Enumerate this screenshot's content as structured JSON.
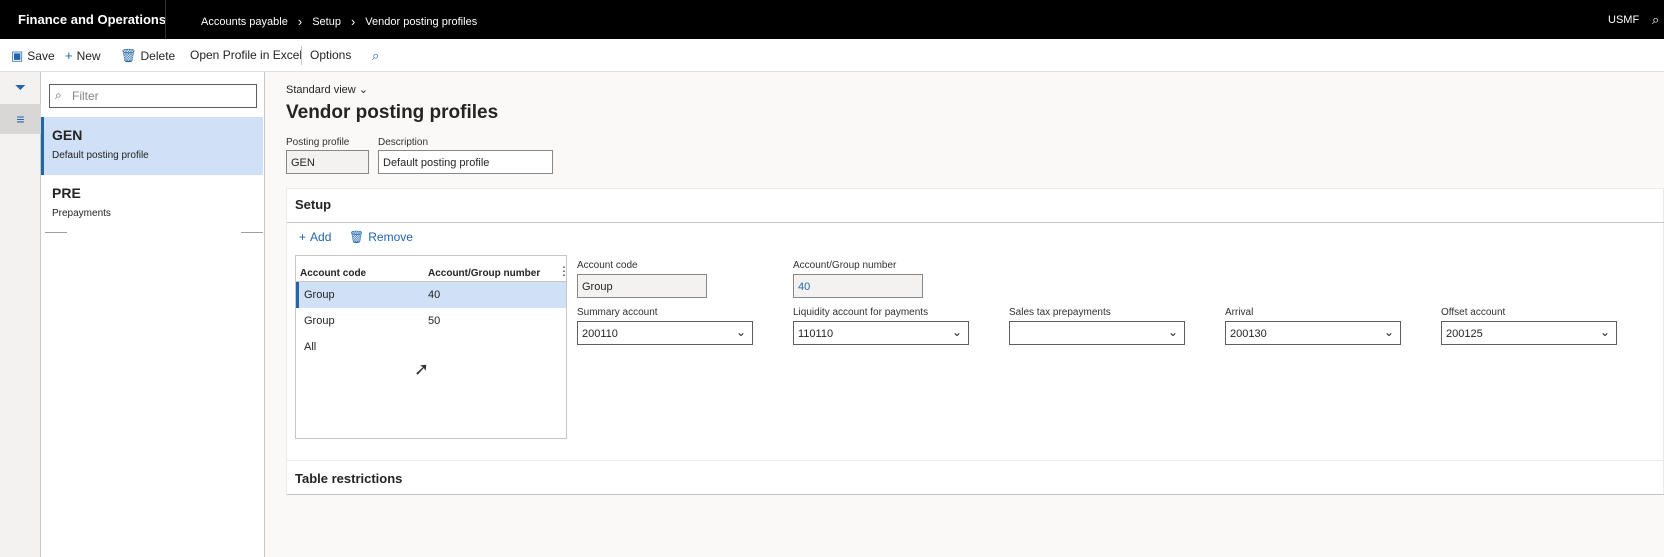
{
  "topbar": {
    "app_name": "Finance and Operations",
    "breadcrumbs": [
      "Accounts payable",
      "Setup",
      "Vendor posting profiles"
    ],
    "company": "USMF"
  },
  "actions": {
    "save": "Save",
    "new": "New",
    "delete": "Delete",
    "open_excel": "Open Profile in Excel",
    "options": "Options"
  },
  "list": {
    "filter_placeholder": "Filter",
    "items": [
      {
        "code": "GEN",
        "description": "Default posting profile",
        "selected": true
      },
      {
        "code": "PRE",
        "description": "Prepayments",
        "selected": false
      }
    ]
  },
  "page": {
    "view": "Standard view",
    "title": "Vendor posting profiles",
    "posting_profile_label": "Posting profile",
    "posting_profile_value": "GEN",
    "description_label": "Description",
    "description_value": "Default posting profile"
  },
  "setup": {
    "title": "Setup",
    "add": "Add",
    "remove": "Remove",
    "grid": {
      "headers": [
        "Account code",
        "Account/Group number"
      ],
      "rows": [
        {
          "account_code": "Group",
          "group_number": "40",
          "selected": true
        },
        {
          "account_code": "Group",
          "group_number": "50",
          "selected": false
        },
        {
          "account_code": "All",
          "group_number": "",
          "selected": false
        }
      ]
    },
    "details": {
      "account_code_label": "Account code",
      "account_code_value": "Group",
      "group_number_label": "Account/Group number",
      "group_number_value": "40",
      "summary_label": "Summary account",
      "summary_value": "200110",
      "liquidity_label": "Liquidity account for payments",
      "liquidity_value": "110110",
      "sales_tax_label": "Sales tax prepayments",
      "sales_tax_value": "",
      "arrival_label": "Arrival",
      "arrival_value": "200130",
      "offset_label": "Offset account",
      "offset_value": "200125"
    }
  },
  "table_restrictions": {
    "title": "Table restrictions"
  },
  "colors": {
    "accent": "#2266aa",
    "selection": "#cfe0f7",
    "topbar": "#000000"
  }
}
